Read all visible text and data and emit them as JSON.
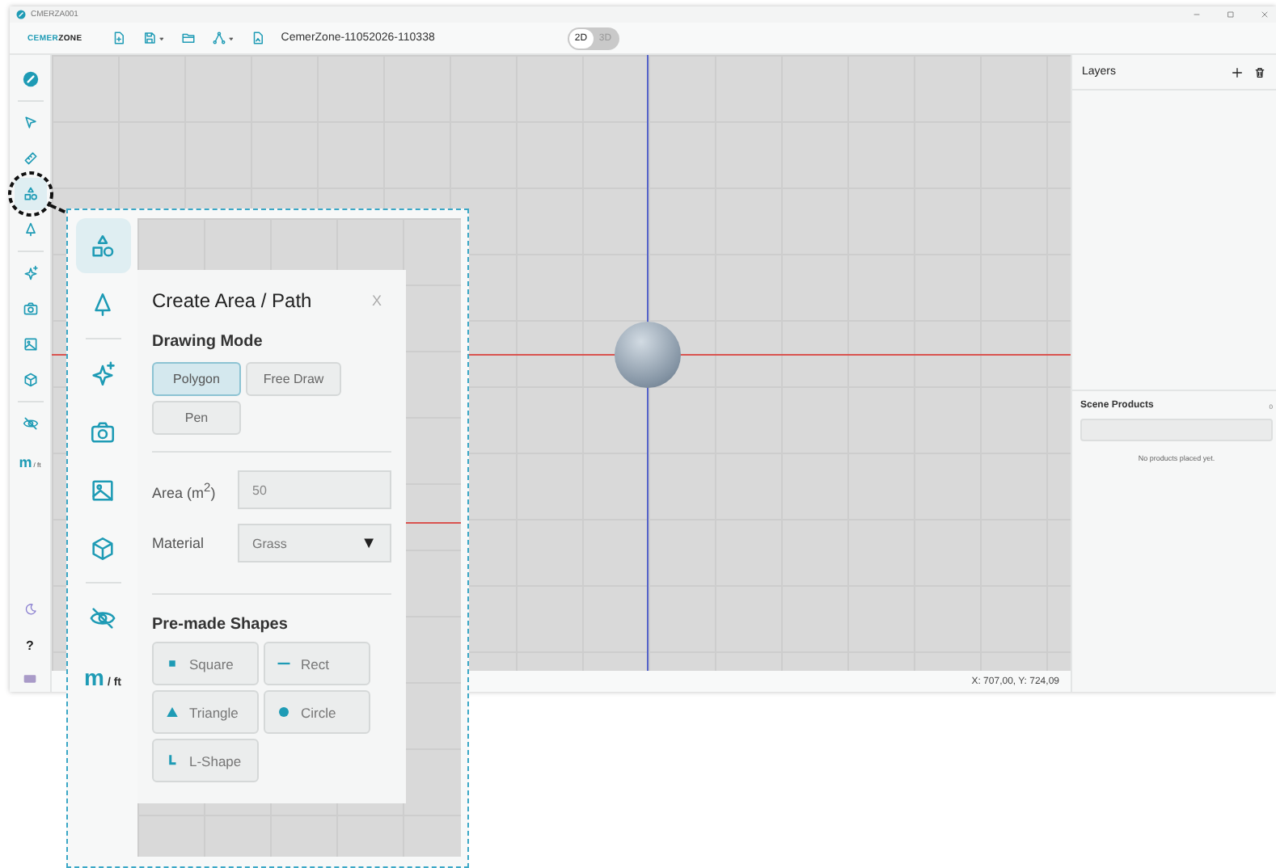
{
  "window": {
    "title": "CMERZA001"
  },
  "toolbar": {
    "logo_first": "CEMER",
    "logo_second": "ZONE",
    "file_name": "CemerZone-11052026-110338",
    "tools": [
      {
        "kind": "new-file",
        "caret": false
      },
      {
        "kind": "save",
        "caret": true
      },
      {
        "kind": "folder",
        "caret": false
      },
      {
        "kind": "network",
        "caret": true
      },
      {
        "kind": "export",
        "caret": false
      }
    ],
    "view_modes": [
      {
        "label": "2D",
        "selected": true
      },
      {
        "label": "3D",
        "selected": false
      }
    ]
  },
  "rail": {
    "tool_groups": [
      {
        "tools": [
          {
            "kind": "logo",
            "selected": false
          }
        ]
      },
      {
        "tools": [
          {
            "kind": "pointer",
            "selected": false
          },
          {
            "kind": "ruler",
            "selected": false
          },
          {
            "kind": "shapes",
            "selected": true
          },
          {
            "kind": "tree",
            "selected": false
          }
        ]
      },
      {
        "tools": [
          {
            "kind": "sparkles",
            "selected": false
          },
          {
            "kind": "camera",
            "selected": false
          },
          {
            "kind": "image",
            "selected": false
          },
          {
            "kind": "cube",
            "selected": false
          }
        ]
      },
      {
        "tools": [
          {
            "kind": "eye-off",
            "selected": false
          }
        ]
      }
    ],
    "unit_main": "m",
    "unit_other": "/ ft",
    "help": "?"
  },
  "canvas": {
    "coordinates": "X: 707,00, Y: 724,09"
  },
  "layers": {
    "title": "Layers"
  },
  "scene_products": {
    "title": "Scene Products",
    "count": "0",
    "empty_message": "No products placed yet."
  },
  "callout": {
    "tool_groups": [
      {
        "tools": [
          {
            "kind": "shapes",
            "selected": true
          },
          {
            "kind": "tree",
            "selected": false
          }
        ]
      },
      {
        "tools": [
          {
            "kind": "sparkles",
            "selected": false
          },
          {
            "kind": "camera",
            "selected": false
          },
          {
            "kind": "image",
            "selected": false
          },
          {
            "kind": "cube",
            "selected": false
          }
        ]
      },
      {
        "tools": [
          {
            "kind": "eye-off",
            "selected": false
          }
        ]
      }
    ],
    "unit_main": "m",
    "unit_other": "/ ft",
    "panel": {
      "title": "Create Area / Path",
      "close": "X",
      "drawing_mode_label": "Drawing Mode",
      "modes": [
        {
          "label": "Polygon",
          "selected": true
        },
        {
          "label": "Free Draw",
          "selected": false
        },
        {
          "label": "Pen",
          "selected": false
        }
      ],
      "area_label": "Area (m$^{2}$)",
      "area_value": "50",
      "material_label": "Material",
      "material_value": "Grass",
      "dropdown_arrow": "▼",
      "shapes_label": "Pre-made Shapes",
      "shapes": [
        {
          "kind": "square",
          "label": "Square"
        },
        {
          "kind": "rect",
          "label": "Rect"
        },
        {
          "kind": "triangle",
          "label": "Triangle"
        },
        {
          "kind": "circle",
          "label": "Circle"
        },
        {
          "kind": "l-shape",
          "label": "L-Shape"
        }
      ]
    }
  }
}
